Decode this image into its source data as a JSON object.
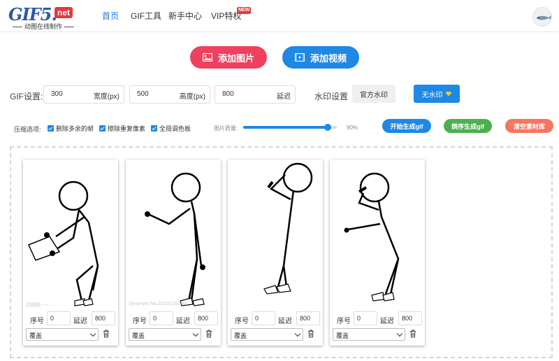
{
  "nav": {
    "logo_main": "GIF5.",
    "logo_badge": "net",
    "logo_sub": "动图在线制作",
    "links": [
      {
        "label": "首页",
        "active": true
      },
      {
        "label": "GIF工具",
        "active": false
      },
      {
        "label": "新手中心",
        "active": false
      },
      {
        "label": "VIP特权",
        "active": false
      }
    ],
    "vip_badge": "NEW"
  },
  "actions": {
    "add_image": "添加图片",
    "add_video": "添加视频"
  },
  "gif_settings": {
    "label": "GIF设置:",
    "width_value": "300",
    "width_unit": "宽度(px)",
    "height_value": "500",
    "height_unit": "高度(px)",
    "delay_value": "800",
    "delay_unit": "延迟",
    "watermark_label": "水印设置",
    "watermark_official": "官方水印",
    "watermark_none": "无水印"
  },
  "compression": {
    "label": "压缩选项:",
    "opt1": "删除多余的帧",
    "opt2": "擦除重复像素",
    "opt3": "全局调色板",
    "quality_label": "图片质量:",
    "quality_percent": 90,
    "quality_text": "90%",
    "start_button": "开始生成gif",
    "reverse_button": "倒序生成gif",
    "clear_button": "清空素材库"
  },
  "frames": [
    {
      "seq_label": "序号",
      "seq": "0",
      "delay_label": "延迟",
      "delay": "800",
      "mode": "覆盖"
    },
    {
      "seq_label": "序号",
      "seq": "0",
      "delay_label": "延迟",
      "delay": "800",
      "mode": "覆盖"
    },
    {
      "seq_label": "序号",
      "seq": "0",
      "delay_label": "延迟",
      "delay": "800",
      "mode": "覆盖"
    },
    {
      "seq_label": "序号",
      "seq": "0",
      "delay_label": "延迟",
      "delay": "800",
      "mode": "覆盖"
    }
  ],
  "colors": {
    "accent_blue": "#1e88e5",
    "red": "#f0405f",
    "green": "#4caf50",
    "salmon": "#f4765f"
  }
}
